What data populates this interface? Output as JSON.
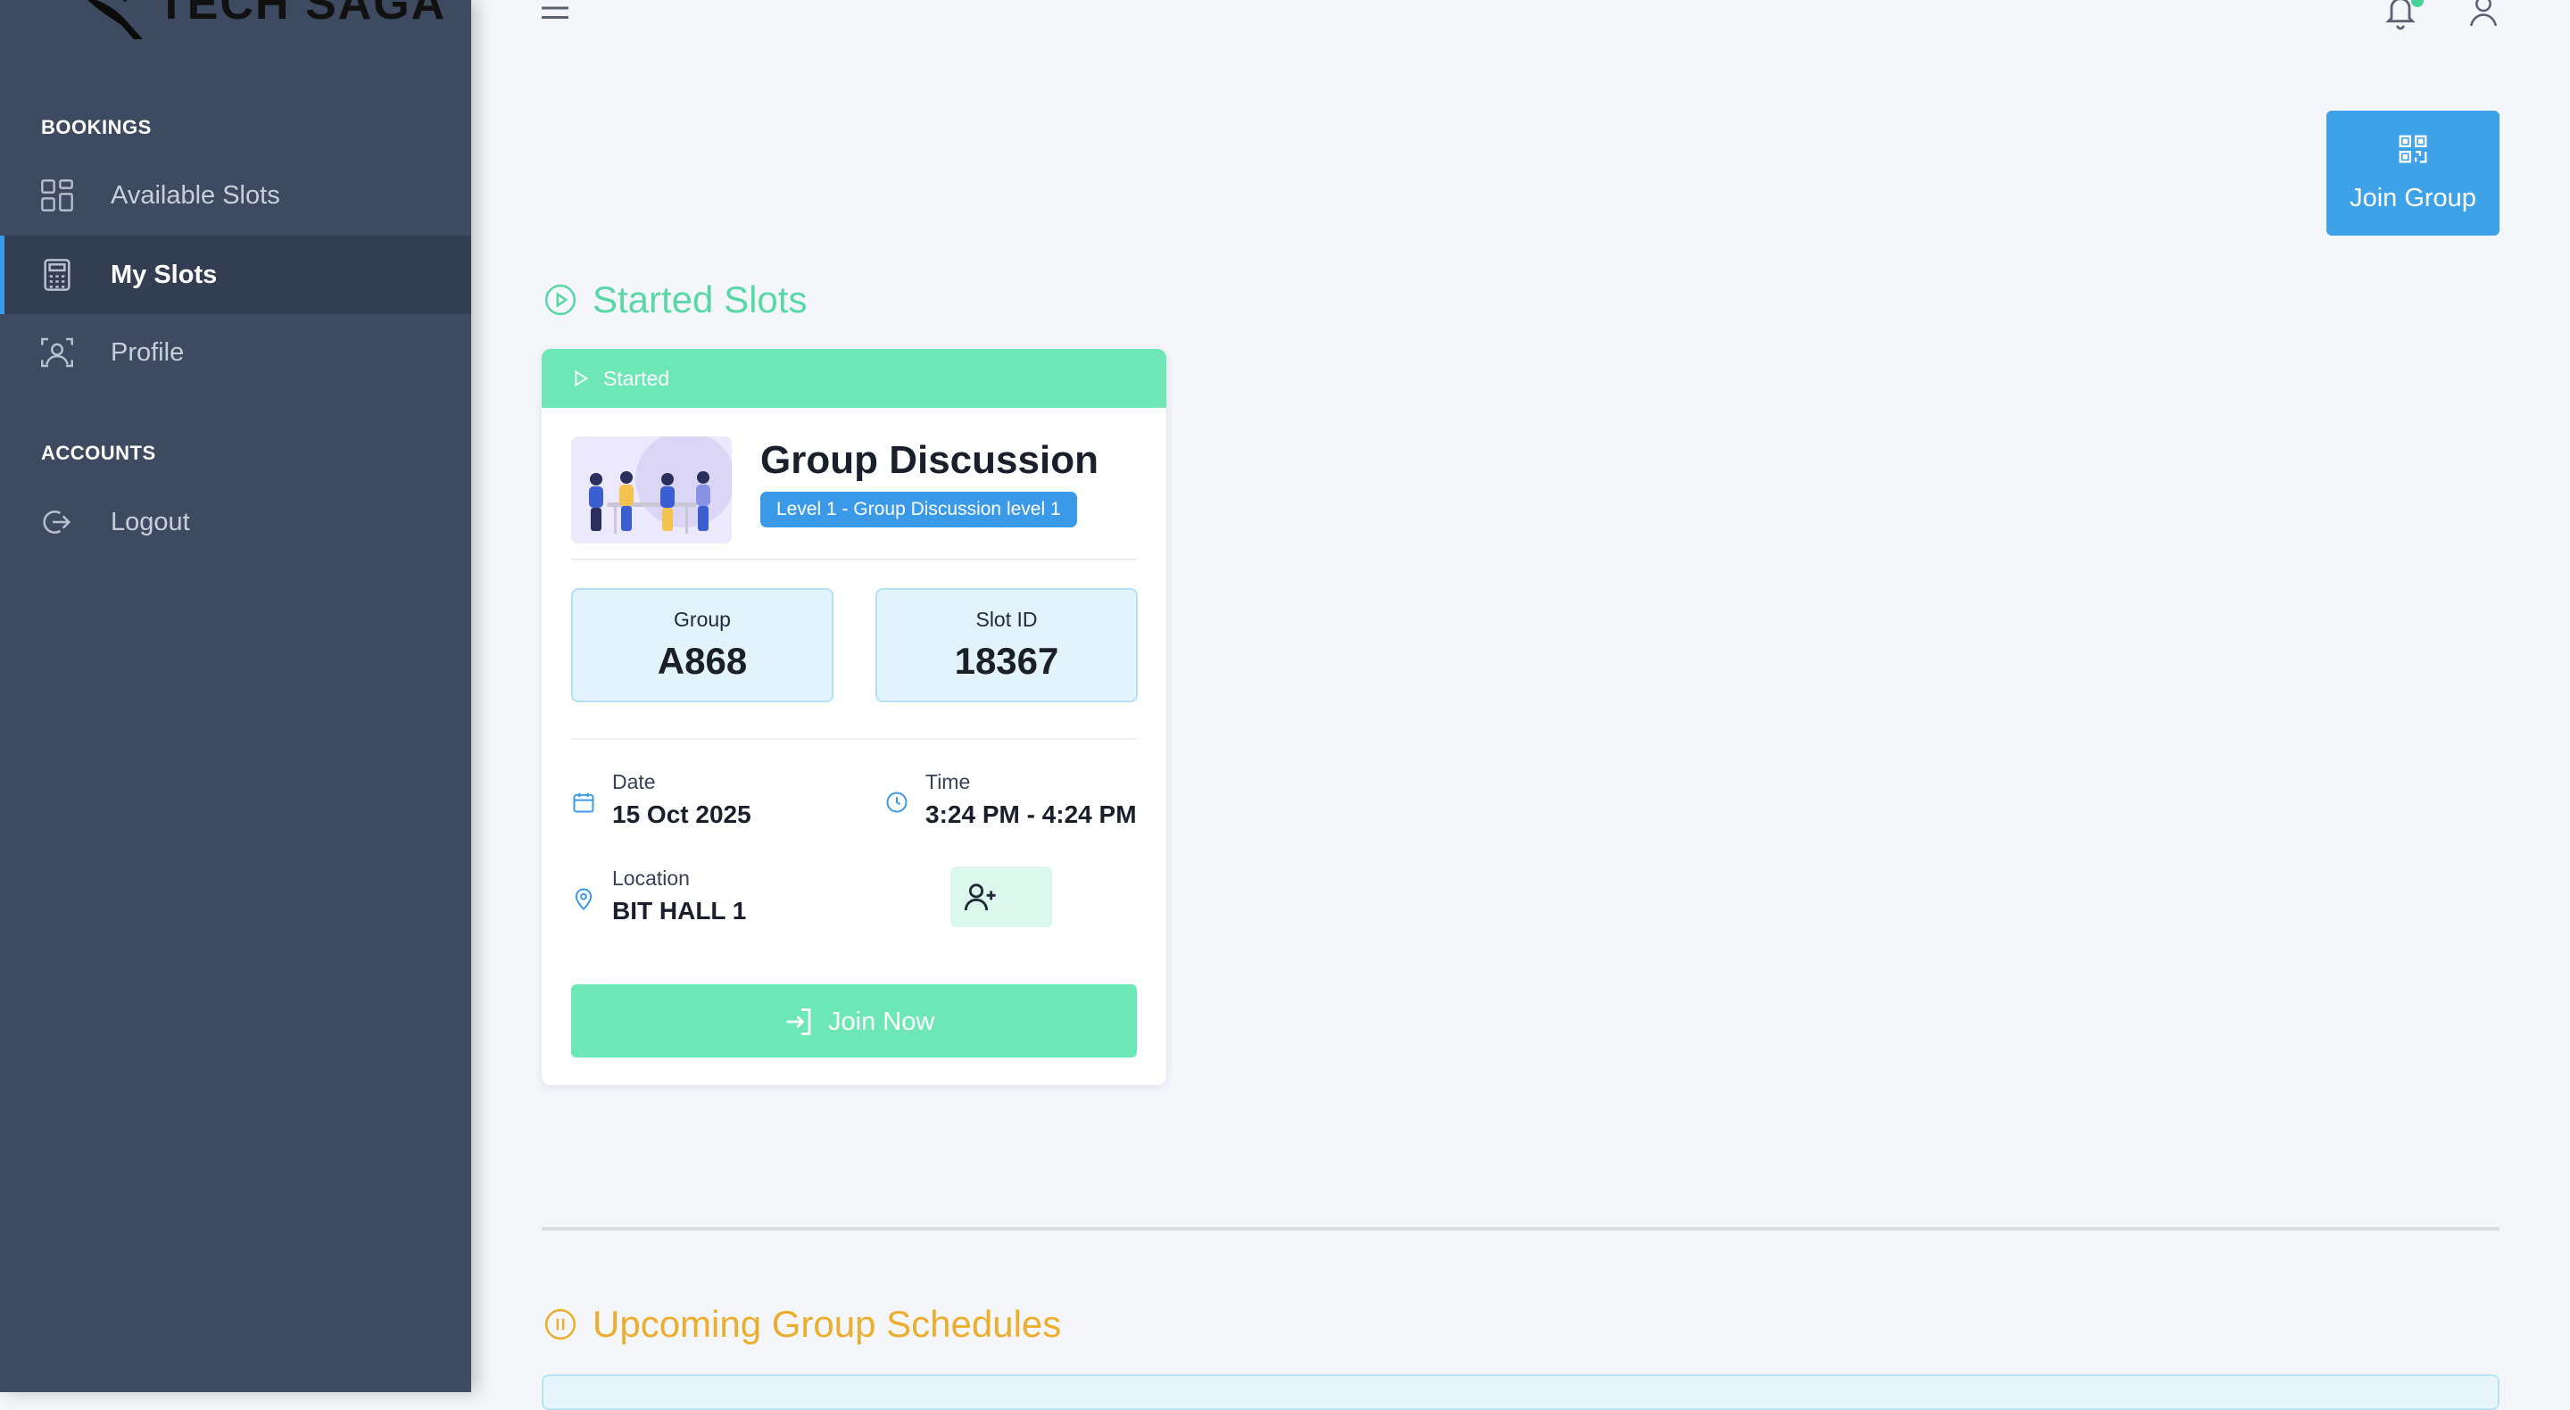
{
  "brand": {
    "name": "TECH SAGA"
  },
  "sidebar": {
    "sections": [
      {
        "heading": "BOOKINGS"
      },
      {
        "heading": "ACCOUNTS"
      }
    ],
    "items": [
      {
        "label": "Available Slots",
        "icon": "grid-icon"
      },
      {
        "label": "My Slots",
        "icon": "calculator-icon",
        "active": true
      },
      {
        "label": "Profile",
        "icon": "profile-icon"
      },
      {
        "label": "Logout",
        "icon": "logout-icon"
      }
    ]
  },
  "header": {
    "menu_icon": "hamburger-icon",
    "notification_icon": "bell-icon",
    "user_icon": "user-icon"
  },
  "actions": {
    "join_group": "Join Group"
  },
  "started": {
    "title": "Started Slots",
    "card": {
      "status": "Started",
      "title": "Group Discussion",
      "level": "Level 1 - Group Discussion level 1",
      "group_label": "Group",
      "group_value": "A868",
      "slot_label": "Slot ID",
      "slot_value": "18367",
      "date_label": "Date",
      "date_value": "15 Oct 2025",
      "time_label": "Time",
      "time_value": "3:24 PM - 4:24 PM",
      "location_label": "Location",
      "location_value": "BIT HALL 1",
      "join_now": "Join Now"
    }
  },
  "upcoming": {
    "title": "Upcoming Group Schedules"
  },
  "colors": {
    "sidebar_bg": "#3e4a60",
    "sidebar_active": "#333e52",
    "accent_blue": "#3b9ae8",
    "started_green": "#6ee7b7",
    "upcoming_orange": "#ecae2e",
    "page_bg": "#f4f6fa"
  }
}
